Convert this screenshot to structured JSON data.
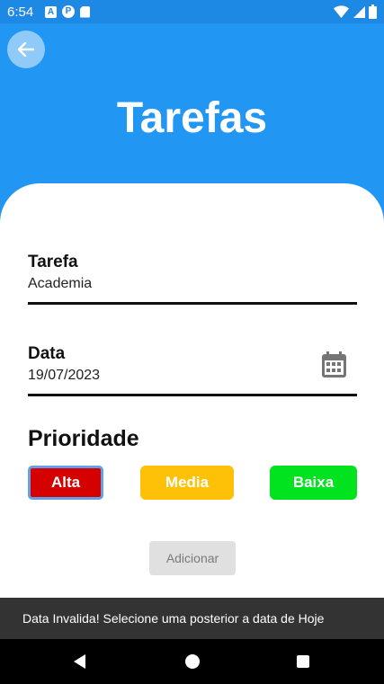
{
  "status_bar": {
    "time": "6:54",
    "icons": [
      "a-notification-icon",
      "p-notification-icon",
      "sd-card-icon",
      "wifi-icon",
      "signal-icon",
      "battery-icon"
    ],
    "notif_a": "A",
    "notif_p": "P"
  },
  "header": {
    "title": "Tarefas",
    "back_icon": "arrow-left-icon",
    "color": "#2196f3"
  },
  "form": {
    "task_label": "Tarefa",
    "task_value": "Academia",
    "date_label": "Data",
    "date_value": "19/07/2023",
    "calendar_icon": "calendar-icon"
  },
  "priority": {
    "title": "Prioridade",
    "options": [
      {
        "label": "Alta",
        "color": "#d50000",
        "selected": true
      },
      {
        "label": "Media",
        "color": "#ffc107",
        "selected": false
      },
      {
        "label": "Baixa",
        "color": "#00e31e",
        "selected": false
      }
    ]
  },
  "actions": {
    "add_label": "Adicionar"
  },
  "snackbar": {
    "message": "Data Invalida! Selecione uma posterior a data de Hoje"
  },
  "nav_bar": {
    "icons": [
      "back-triangle-icon",
      "home-circle-icon",
      "recents-square-icon"
    ]
  }
}
